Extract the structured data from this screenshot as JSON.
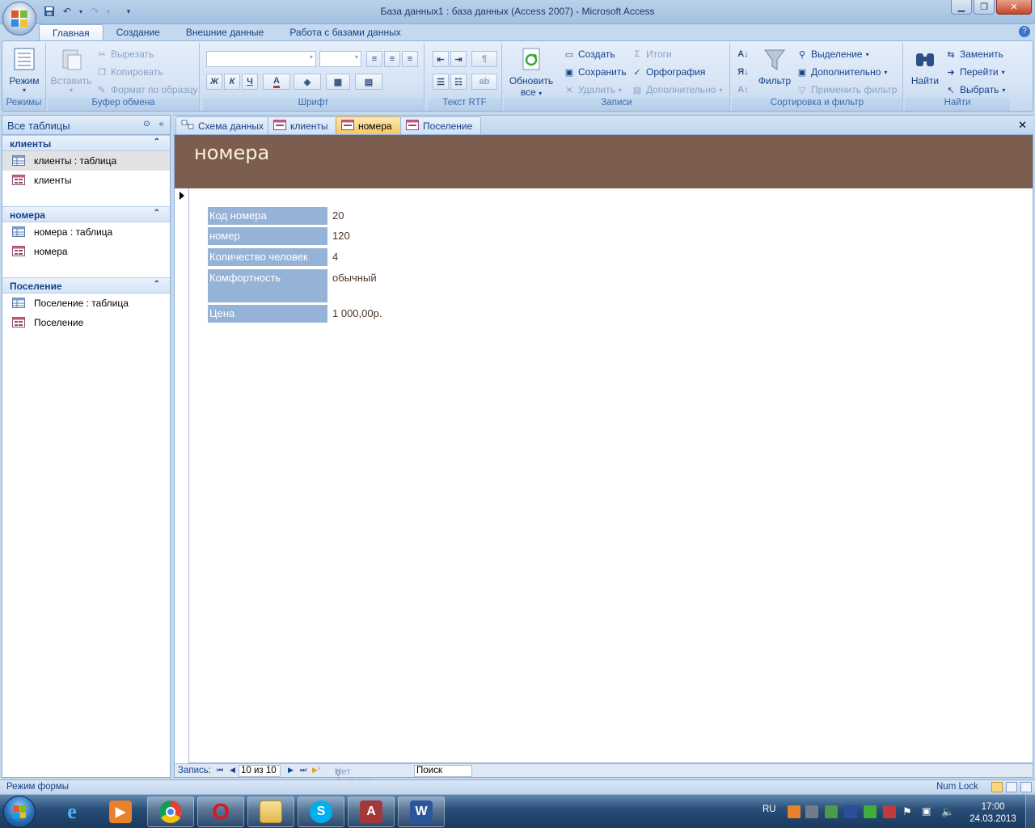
{
  "window": {
    "title": "База данных1 : база данных (Access 2007) - Microsoft Access",
    "controls": [
      "minimize",
      "maximize",
      "close"
    ]
  },
  "ribbon_tabs": [
    "Главная",
    "Создание",
    "Внешние данные",
    "Работа с базами данных"
  ],
  "ribbon": {
    "groups": {
      "views": "Режимы",
      "clipboard": "Буфер обмена",
      "font": "Шрифт",
      "rtf": "Текст RTF",
      "records": "Записи",
      "sort_filter": "Сортировка и фильтр",
      "find": "Найти"
    },
    "view_button": "Режим",
    "paste_button": "Вставить",
    "cut": "Вырезать",
    "copy": "Копировать",
    "format_painter": "Формат по образцу",
    "bold": "Ж",
    "italic": "К",
    "underline": "Ч",
    "font_color_letter": "A",
    "refresh_line1": "Обновить",
    "refresh_line2": "все",
    "new": "Создать",
    "save": "Сохранить",
    "delete": "Удалить",
    "totals": "Итоги",
    "spelling": "Орфография",
    "more": "Дополнительно",
    "filter": "Фильтр",
    "selection": "Выделение",
    "advanced": "Дополнительно",
    "apply_filter": "Применить фильтр",
    "find": "Найти",
    "replace": "Заменить",
    "goto": "Перейти",
    "select": "Выбрать"
  },
  "nav": {
    "title": "Все таблицы",
    "groups": [
      {
        "label": "клиенты",
        "items": [
          {
            "label": "клиенты : таблица",
            "icon": "table-icon"
          },
          {
            "label": "клиенты",
            "icon": "form-icon"
          }
        ]
      },
      {
        "label": "номера",
        "items": [
          {
            "label": "номера : таблица",
            "icon": "table-icon"
          },
          {
            "label": "номера",
            "icon": "form-icon"
          }
        ]
      },
      {
        "label": "Поселение",
        "items": [
          {
            "label": "Поселение : таблица",
            "icon": "table-icon"
          },
          {
            "label": "Поселение",
            "icon": "form-icon"
          }
        ]
      }
    ]
  },
  "doc_tabs": [
    {
      "label": "Схема данных",
      "icon": "relationships-icon"
    },
    {
      "label": "клиенты",
      "icon": "form-icon"
    },
    {
      "label": "номера",
      "icon": "form-icon",
      "active": true
    },
    {
      "label": "Поселение",
      "icon": "form-icon"
    }
  ],
  "form": {
    "title": "номера",
    "fields": [
      {
        "label": "Код номера",
        "value": "20"
      },
      {
        "label": "номер",
        "value": "120"
      },
      {
        "label": "Количество человек",
        "value": "4"
      },
      {
        "label": "Комфортность",
        "value": "обычный"
      },
      {
        "label": "Цена",
        "value": "1 000,00р."
      }
    ]
  },
  "record_nav": {
    "label": "Запись:",
    "position": "10 из 10",
    "filter_status": "Нет фильтра",
    "search": "Поиск"
  },
  "status": {
    "mode": "Режим формы",
    "numlock": "Num Lock"
  },
  "taskbar": {
    "lang": "RU",
    "time": "17:00",
    "date": "24.03.2013"
  },
  "colors": {
    "form_header": "#7b5e4f",
    "label_bg": "#95b3d7",
    "active_tab": "#f5c763",
    "ribbon_text": "#15428b"
  }
}
